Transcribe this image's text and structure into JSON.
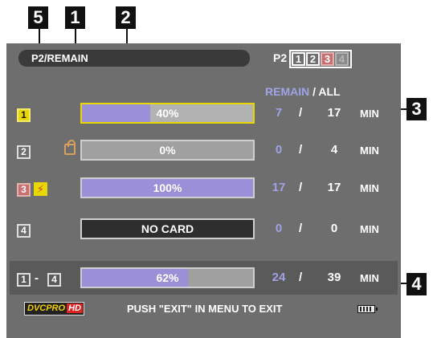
{
  "callouts": [
    "5",
    "1",
    "2",
    "3",
    "4"
  ],
  "header": {
    "title": "P2/REMAIN",
    "p2_label": "P2",
    "slot_boxes": [
      "1",
      "2",
      "3",
      "4"
    ]
  },
  "column_header": {
    "remain": "REMAIN",
    "sep": " / ",
    "all": "ALL"
  },
  "rows": [
    {
      "slot": "1",
      "percent": 40,
      "bar_label": "40%",
      "remain": "7",
      "sep": "/",
      "all": "17",
      "unit": "MIN"
    },
    {
      "slot": "2",
      "percent": 0,
      "bar_label": "0%",
      "remain": "0",
      "sep": "/",
      "all": "4",
      "unit": "MIN"
    },
    {
      "slot": "3",
      "percent": 100,
      "bar_label": "100%",
      "remain": "17",
      "sep": "/",
      "all": "17",
      "unit": "MIN"
    },
    {
      "slot": "4",
      "percent": 0,
      "bar_label": "NO CARD",
      "remain": "0",
      "sep": "/",
      "all": "0",
      "unit": "MIN"
    }
  ],
  "total": {
    "slot_from": "1",
    "dash": "-",
    "slot_to": "4",
    "percent": 62,
    "bar_label": "62%",
    "remain": "24",
    "sep": "/",
    "all": "39",
    "unit": "MIN"
  },
  "footer": {
    "logo": "DVCPRO",
    "logo_hd": "HD",
    "message": "PUSH \"EXIT\" IN MENU TO EXIT"
  },
  "colors": {
    "screen_bg": "#6e6e6e",
    "remain_blue": "#9ea3e6",
    "bar_fill": "#9b8fd8",
    "selected_yellow": "#e8d800"
  },
  "icons": {
    "lock": "lock-icon",
    "warning": "bolt-icon",
    "battery": "battery-icon"
  }
}
